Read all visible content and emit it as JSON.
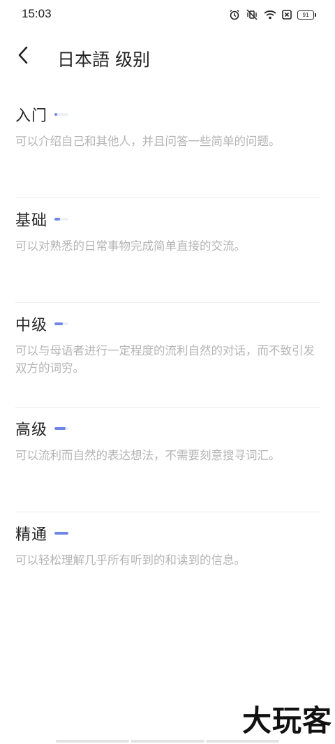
{
  "status_bar": {
    "time": "15:03",
    "battery": "91"
  },
  "header": {
    "title": "日本語 级别",
    "back_icon": "chevron-left-icon"
  },
  "levels": [
    {
      "name": "入门",
      "progress": 0.2,
      "description": "可以介绍自己和其他人，并且问答一些简单的问题。"
    },
    {
      "name": "基础",
      "progress": 0.4,
      "description": "可以对熟悉的日常事物完成简单直接的交流。"
    },
    {
      "name": "中级",
      "progress": 0.6,
      "description": "可以与母语者进行一定程度的流利自然的对话，而不致引发双方的词穷。"
    },
    {
      "name": "高级",
      "progress": 0.8,
      "description": "可以流利而自然的表达想法，不需要刻意搜寻词汇。"
    },
    {
      "name": "精通",
      "progress": 1.0,
      "description": "可以轻松理解几乎所有听到的和读到的信息。"
    }
  ],
  "watermark": "大玩客",
  "colors": {
    "accent": "#6f86e6",
    "meter_track": "#eef0fa",
    "description": "#b4b4b4"
  }
}
